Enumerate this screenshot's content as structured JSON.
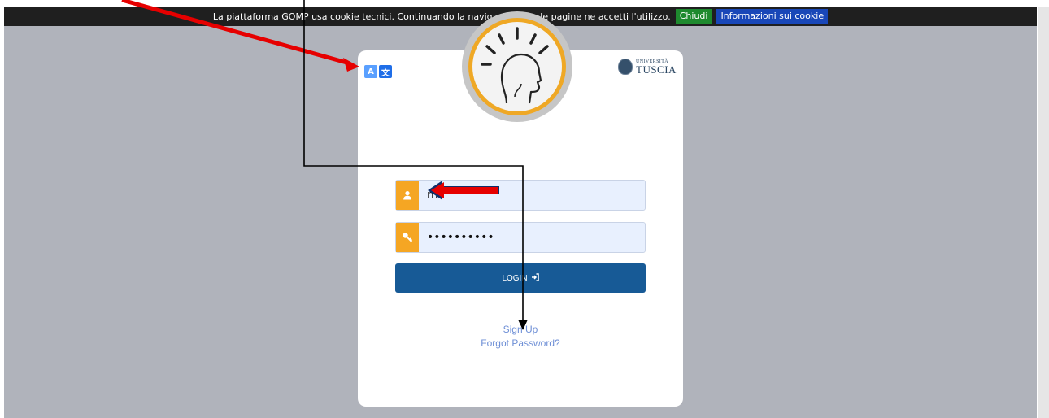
{
  "cookie_bar": {
    "message": "La piattaforma GOMP usa cookie tecnici. Continuando la navigazione tra le pagine ne accetti l'utilizzo.",
    "close_label": "Chiudi",
    "info_label": "Informazioni sui cookie"
  },
  "lang_toggle": {
    "letter_a": "A",
    "letter_b": "文"
  },
  "university_logo": {
    "small": "UNIVERSITÀ",
    "big": "TUSCIA"
  },
  "login_form": {
    "username_value": "m",
    "password_value": "••••••••••",
    "login_label": "LOGIN",
    "signup_label": "Sign Up",
    "forgot_label": "Forgot Password?"
  },
  "colors": {
    "accent_orange": "#f5a623",
    "login_blue": "#175a96",
    "cookie_green": "#1e8a2e",
    "cookie_blue": "#1947b8",
    "annotation_red": "#e60000"
  }
}
